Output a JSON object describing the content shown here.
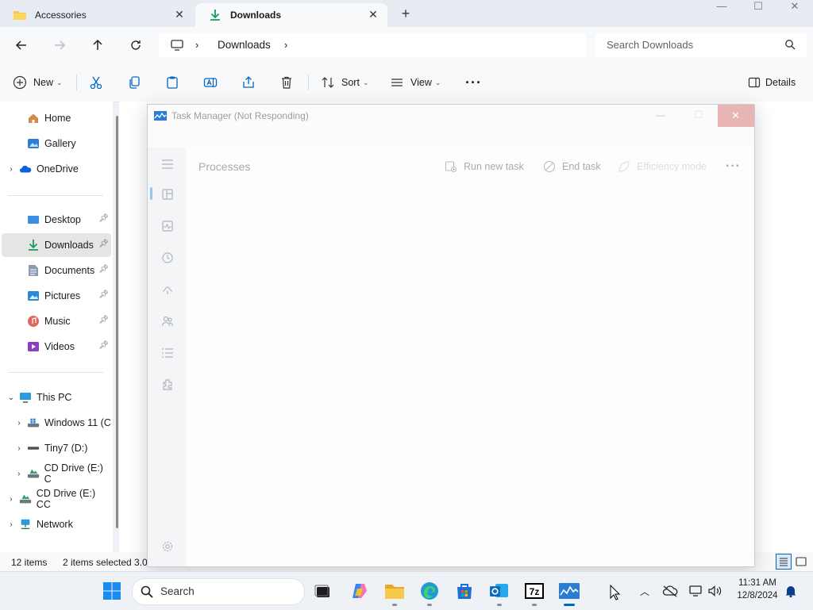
{
  "tabs": [
    {
      "label": "Accessories"
    },
    {
      "label": "Downloads"
    }
  ],
  "address": {
    "segments": [
      "Downloads"
    ]
  },
  "search": {
    "placeholder": "Search Downloads"
  },
  "toolbar": {
    "new_label": "New",
    "sort_label": "Sort",
    "view_label": "View",
    "details_label": "Details"
  },
  "sidebar": {
    "items": [
      {
        "label": "Home"
      },
      {
        "label": "Gallery"
      },
      {
        "label": "OneDrive"
      },
      {
        "label": "Desktop"
      },
      {
        "label": "Downloads"
      },
      {
        "label": "Documents"
      },
      {
        "label": "Pictures"
      },
      {
        "label": "Music"
      },
      {
        "label": "Videos"
      },
      {
        "label": "This PC"
      },
      {
        "label": "Windows 11 (C"
      },
      {
        "label": "Tiny7 (D:)"
      },
      {
        "label": "CD Drive (E:) C"
      },
      {
        "label": "CD Drive (E:) CC"
      },
      {
        "label": "Network"
      }
    ]
  },
  "status": {
    "items_count": "12 items",
    "selected": "2 items selected  3.0"
  },
  "taskmanager": {
    "title": "Task Manager (Not Responding)",
    "page_title": "Processes",
    "run_new_task": "Run new task",
    "end_task": "End task",
    "efficiency_mode": "Efficiency mode"
  },
  "taskbar": {
    "search_label": "Search",
    "time": "11:31 AM",
    "date": "12/8/2024"
  },
  "colors": {
    "accent": "#0067c0",
    "folder": "#f7c948",
    "download_green": "#1a9b5c",
    "close_hover": "#e8b4b4"
  }
}
